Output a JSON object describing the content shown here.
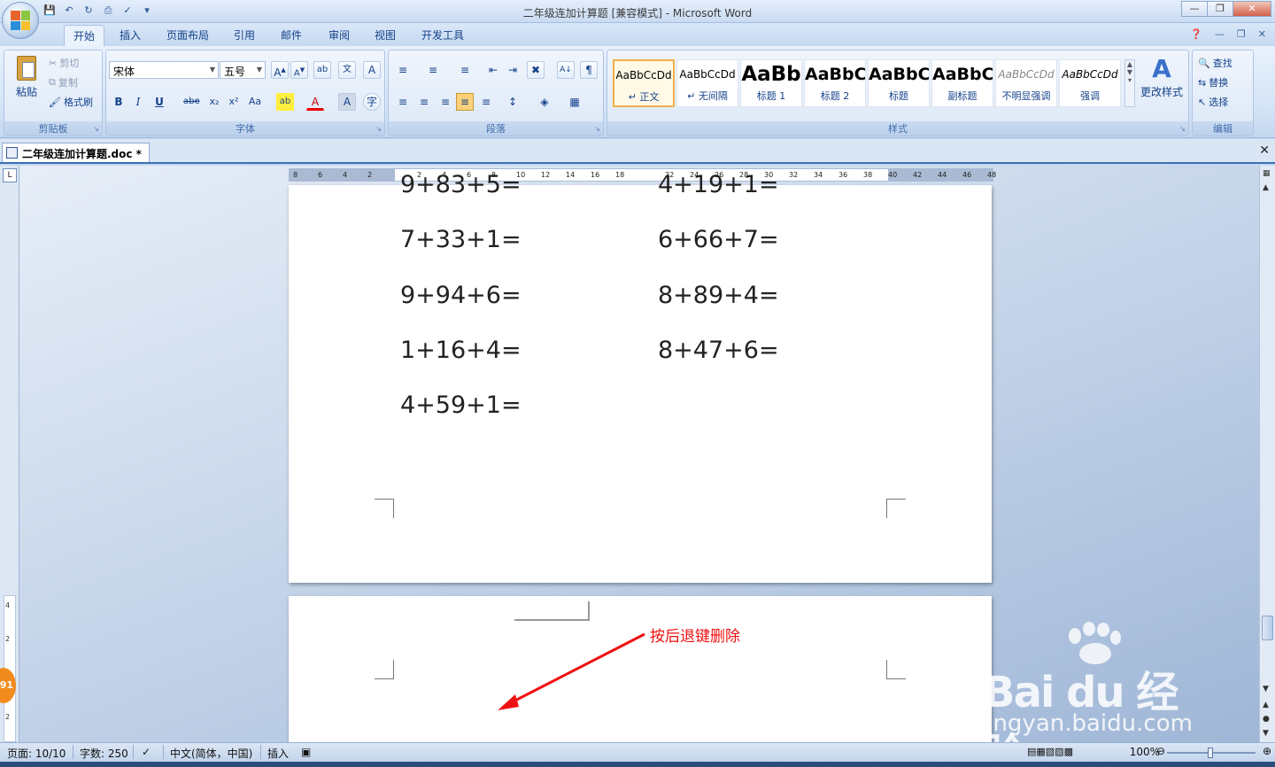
{
  "window": {
    "title": "二年级连加计算题 [兼容模式] - Microsoft Word"
  },
  "ribbon_tabs": [
    "开始",
    "插入",
    "页面布局",
    "引用",
    "邮件",
    "审阅",
    "视图",
    "开发工具"
  ],
  "clipboard": {
    "paste": "粘贴",
    "cut": "剪切",
    "copy": "复制",
    "format_painter": "格式刷",
    "group_label": "剪贴板"
  },
  "font": {
    "font_name": "宋体",
    "font_size": "五号",
    "group_label": "字体"
  },
  "paragraph": {
    "group_label": "段落"
  },
  "styles": {
    "group_label": "样式",
    "items": [
      {
        "sample": "AaBbCcDd",
        "name": "↵ 正文"
      },
      {
        "sample": "AaBbCcDd",
        "name": "↵ 无间隔"
      },
      {
        "sample": "AaBb",
        "name": "标题 1"
      },
      {
        "sample": "AaBbC",
        "name": "标题 2"
      },
      {
        "sample": "AaBbC",
        "name": "标题"
      },
      {
        "sample": "AaBbC",
        "name": "副标题"
      },
      {
        "sample": "AaBbCcDd",
        "name": "不明显强调"
      },
      {
        "sample": "AaBbCcDd",
        "name": "强调"
      }
    ],
    "change_styles": "更改样式"
  },
  "editing": {
    "find": "查找",
    "replace": "替换",
    "select": "选择",
    "group_label": "编辑"
  },
  "document_tab": {
    "label": "二年级连加计算题.doc *"
  },
  "ruler": {
    "ticks": [
      "8",
      "6",
      "4",
      "2",
      "",
      "2",
      "4",
      "6",
      "8",
      "10",
      "12",
      "14",
      "16",
      "18",
      "",
      "22",
      "24",
      "26",
      "28",
      "30",
      "32",
      "34",
      "36",
      "38",
      "40",
      "42",
      "44",
      "46",
      "48"
    ]
  },
  "page1": {
    "equations_left": [
      "9+83+5=",
      "7+33+1=",
      "9+94+6=",
      "1+16+4=",
      "4+59+1="
    ],
    "equations_right": [
      "4+19+1=",
      "6+66+7=",
      "8+89+4=",
      "8+47+6="
    ]
  },
  "annotation": {
    "text": "按后退键删除",
    "color": "#e11111"
  },
  "side_badge": "91",
  "watermark": {
    "brand": "Bai du 经验",
    "url": "jingyan.baidu.com"
  },
  "status": {
    "page": "页面: 10/10",
    "words": "字数: 250",
    "language": "中文(简体，中国)",
    "mode": "插入",
    "zoom": "100%"
  }
}
